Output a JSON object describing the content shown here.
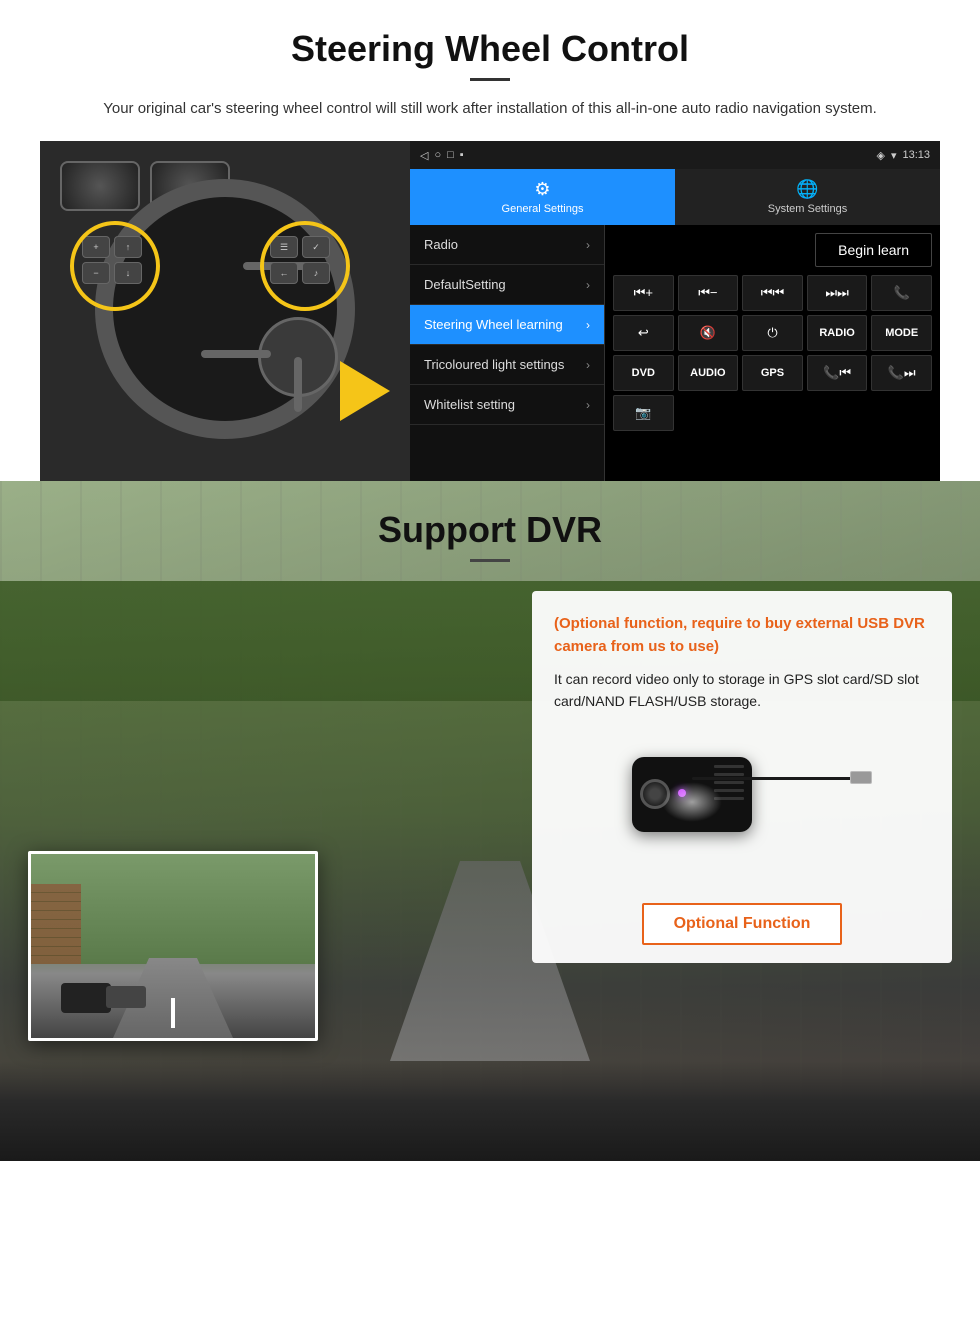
{
  "page": {
    "section1": {
      "title": "Steering Wheel Control",
      "subtitle": "Your original car's steering wheel control will still work after installation of this all-in-one auto radio navigation system.",
      "status_bar": {
        "time": "13:13",
        "icons": [
          "wifi",
          "signal",
          "battery"
        ]
      },
      "tabs": [
        {
          "label": "General Settings",
          "icon": "⚙",
          "active": true
        },
        {
          "label": "System Settings",
          "icon": "🌐",
          "active": false
        }
      ],
      "menu_items": [
        {
          "label": "Radio",
          "active": false
        },
        {
          "label": "DefaultSetting",
          "active": false
        },
        {
          "label": "Steering Wheel learning",
          "active": true
        },
        {
          "label": "Tricoloured light settings",
          "active": false
        },
        {
          "label": "Whitelist setting",
          "active": false
        }
      ],
      "begin_learn_label": "Begin learn",
      "control_buttons": [
        "⏮+",
        "⏮-",
        "⏮⏮",
        "⏭⏭",
        "📞",
        "↩",
        "🔇",
        "⏻",
        "RADIO",
        "MODE",
        "DVD",
        "AUDIO",
        "GPS",
        "📞⏮",
        "📞⏭",
        "📷"
      ]
    },
    "section2": {
      "title": "Support DVR",
      "optional_text": "(Optional function, require to buy external USB DVR camera from us to use)",
      "description": "It can record video only to storage in GPS slot card/SD slot card/NAND FLASH/USB storage.",
      "optional_function_btn": "Optional Function"
    }
  }
}
